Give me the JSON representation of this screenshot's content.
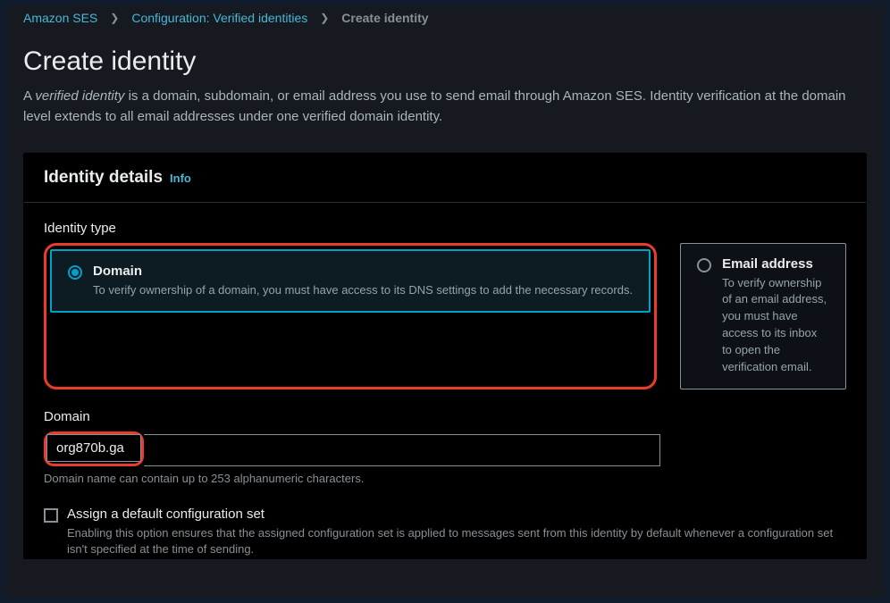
{
  "breadcrumb": {
    "root": "Amazon SES",
    "mid": "Configuration: Verified identities",
    "current": "Create identity"
  },
  "page": {
    "title": "Create identity",
    "subtitle_prefix": "A ",
    "subtitle_em": "verified identity",
    "subtitle_rest": " is a domain, subdomain, or email address you use to send email through Amazon SES. Identity verification at the domain level extends to all email addresses under one verified domain identity."
  },
  "panel": {
    "title": "Identity details",
    "info": "Info"
  },
  "identity_type": {
    "label": "Identity type",
    "domain": {
      "title": "Domain",
      "desc": "To verify ownership of a domain, you must have access to its DNS settings to add the necessary records."
    },
    "email": {
      "title": "Email address",
      "desc": "To verify ownership of an email address, you must have access to its inbox to open the verification email."
    }
  },
  "domain_field": {
    "label": "Domain",
    "value": "org870b.ga",
    "hint": "Domain name can contain up to 253 alphanumeric characters."
  },
  "config_set": {
    "label": "Assign a default configuration set",
    "desc": "Enabling this option ensures that the assigned configuration set is applied to messages sent from this identity by default whenever a configuration set isn't specified at the time of sending."
  }
}
